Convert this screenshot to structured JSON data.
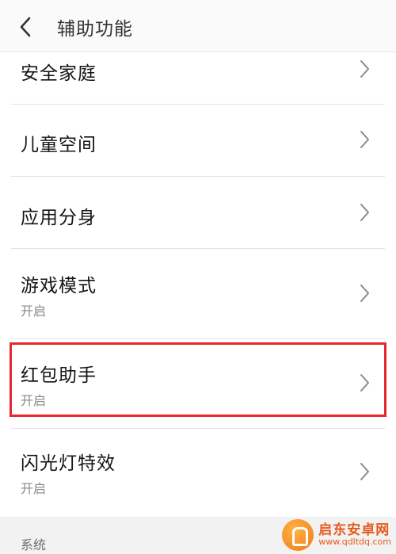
{
  "header": {
    "title": "辅助功能",
    "back_icon": "chevron-left-icon"
  },
  "items": [
    {
      "title": "安全家庭",
      "subtitle": ""
    },
    {
      "title": "儿童空间",
      "subtitle": ""
    },
    {
      "title": "应用分身",
      "subtitle": ""
    },
    {
      "title": "游戏模式",
      "subtitle": "开启"
    },
    {
      "title": "红包助手",
      "subtitle": "开启"
    },
    {
      "title": "闪光灯特效",
      "subtitle": "开启"
    }
  ],
  "section": {
    "label": "系统"
  },
  "watermark": {
    "name": "启东安卓网",
    "url": "www.qdltdq.com"
  },
  "colors": {
    "highlight": "#e8262e",
    "watermark": "#e7591c"
  }
}
